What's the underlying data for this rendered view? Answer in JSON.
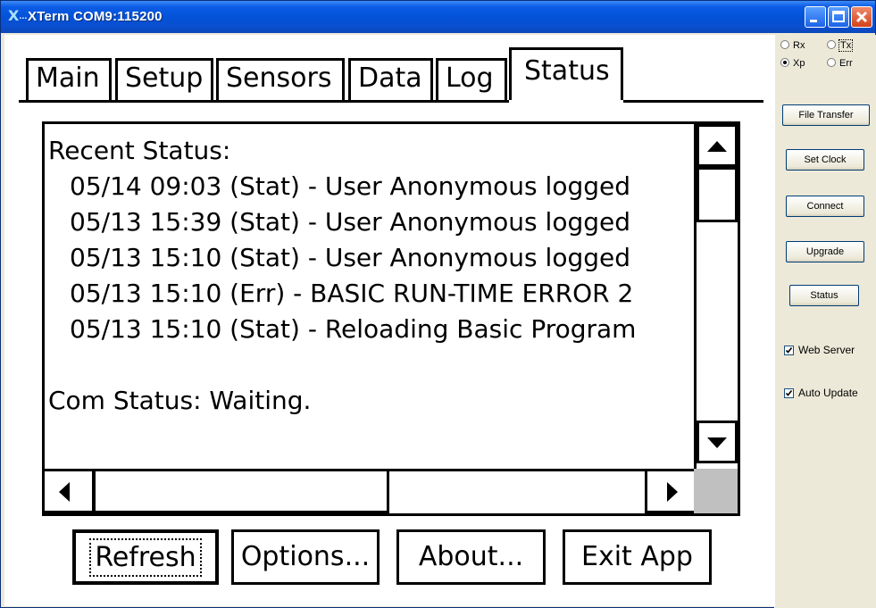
{
  "window": {
    "title": "XTerm COM9:115200",
    "app_icon": "X",
    "title_color": "#0352d8"
  },
  "tabs": [
    {
      "label": "Main",
      "active": false
    },
    {
      "label": "Setup",
      "active": false
    },
    {
      "label": "Sensors",
      "active": false
    },
    {
      "label": "Data",
      "active": false
    },
    {
      "label": "Log",
      "active": false
    },
    {
      "label": "Status",
      "active": true
    }
  ],
  "status_list": {
    "header": "Recent Status:",
    "entries": [
      "05/14 09:03 (Stat) - User Anonymous logged",
      "05/13 15:39 (Stat) - User Anonymous logged",
      "05/13 15:10 (Stat) - User Anonymous logged",
      "05/13 15:10 (Err) - BASIC RUN-TIME ERROR 2",
      "05/13 15:10 (Stat) - Reloading Basic Program"
    ],
    "com_status": "Com Status: Waiting."
  },
  "buttons": {
    "refresh": "Refresh",
    "options": "Options...",
    "about": "About...",
    "exit": "Exit App"
  },
  "side_panel": {
    "radios": [
      {
        "label": "Rx",
        "checked": false
      },
      {
        "label": "Tx",
        "checked": false
      },
      {
        "label": "Xp",
        "checked": true
      },
      {
        "label": "Err",
        "checked": false
      }
    ],
    "buttons": {
      "file_transfer": "File Transfer",
      "set_clock": "Set Clock",
      "connect": "Connect",
      "upgrade": "Upgrade",
      "status": "Status"
    },
    "checkboxes": [
      {
        "label": "Web Server",
        "checked": true
      },
      {
        "label": "Auto Update",
        "checked": true
      }
    ]
  }
}
